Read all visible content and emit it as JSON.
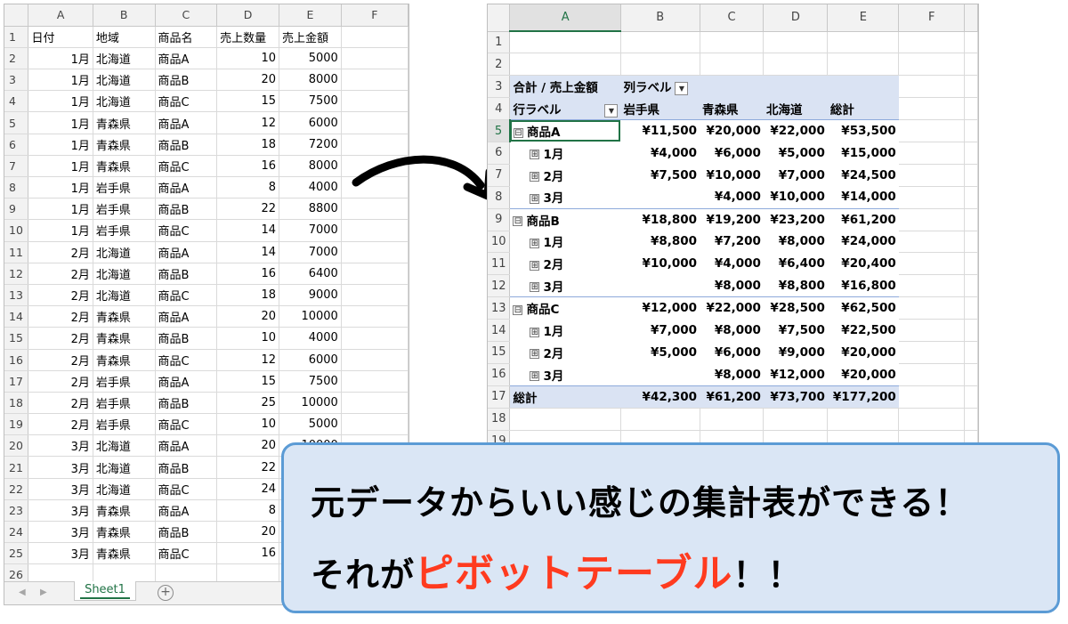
{
  "left_sheet": {
    "columns": [
      "A",
      "B",
      "C",
      "D",
      "E",
      "F"
    ],
    "headers": [
      "日付",
      "地域",
      "商品名",
      "売上数量",
      "売上金額"
    ],
    "rows": [
      [
        "1月",
        "北海道",
        "商品A",
        "10",
        "5000"
      ],
      [
        "1月",
        "北海道",
        "商品B",
        "20",
        "8000"
      ],
      [
        "1月",
        "北海道",
        "商品C",
        "15",
        "7500"
      ],
      [
        "1月",
        "青森県",
        "商品A",
        "12",
        "6000"
      ],
      [
        "1月",
        "青森県",
        "商品B",
        "18",
        "7200"
      ],
      [
        "1月",
        "青森県",
        "商品C",
        "16",
        "8000"
      ],
      [
        "1月",
        "岩手県",
        "商品A",
        "8",
        "4000"
      ],
      [
        "1月",
        "岩手県",
        "商品B",
        "22",
        "8800"
      ],
      [
        "1月",
        "岩手県",
        "商品C",
        "14",
        "7000"
      ],
      [
        "2月",
        "北海道",
        "商品A",
        "14",
        "7000"
      ],
      [
        "2月",
        "北海道",
        "商品B",
        "16",
        "6400"
      ],
      [
        "2月",
        "北海道",
        "商品C",
        "18",
        "9000"
      ],
      [
        "2月",
        "青森県",
        "商品A",
        "20",
        "10000"
      ],
      [
        "2月",
        "青森県",
        "商品B",
        "10",
        "4000"
      ],
      [
        "2月",
        "青森県",
        "商品C",
        "12",
        "6000"
      ],
      [
        "2月",
        "岩手県",
        "商品A",
        "15",
        "7500"
      ],
      [
        "2月",
        "岩手県",
        "商品B",
        "25",
        "10000"
      ],
      [
        "2月",
        "岩手県",
        "商品C",
        "10",
        "5000"
      ],
      [
        "3月",
        "北海道",
        "商品A",
        "20",
        "10000"
      ],
      [
        "3月",
        "北海道",
        "商品B",
        "22",
        ""
      ],
      [
        "3月",
        "北海道",
        "商品C",
        "24",
        ""
      ],
      [
        "3月",
        "青森県",
        "商品A",
        "8",
        ""
      ],
      [
        "3月",
        "青森県",
        "商品B",
        "20",
        ""
      ],
      [
        "3月",
        "青森県",
        "商品C",
        "16",
        ""
      ]
    ],
    "row_numbers": [
      "1",
      "2",
      "3",
      "4",
      "5",
      "6",
      "7",
      "8",
      "9",
      "10",
      "11",
      "12",
      "13",
      "14",
      "15",
      "16",
      "17",
      "18",
      "19",
      "20",
      "21",
      "22",
      "23",
      "24",
      "25",
      "26"
    ],
    "sheet_tab": "Sheet1",
    "add_sheet": "+"
  },
  "right_sheet": {
    "columns": [
      "A",
      "B",
      "C",
      "D",
      "E",
      "F"
    ],
    "row_numbers": [
      "1",
      "2",
      "3",
      "4",
      "5",
      "6",
      "7",
      "8",
      "9",
      "10",
      "11",
      "12",
      "13",
      "14",
      "15",
      "16",
      "17",
      "18",
      "19"
    ],
    "pivot": {
      "value_label": "合計 / 売上金額",
      "column_label": "列ラベル",
      "row_label": "行ラベル",
      "col_headers": [
        "岩手県",
        "青森県",
        "北海道",
        "総計"
      ],
      "groups": [
        {
          "name": "商品A",
          "values": [
            "¥11,500",
            "¥20,000",
            "¥22,000",
            "¥53,500"
          ],
          "months": [
            {
              "name": "1月",
              "values": [
                "¥4,000",
                "¥6,000",
                "¥5,000",
                "¥15,000"
              ]
            },
            {
              "name": "2月",
              "values": [
                "¥7,500",
                "¥10,000",
                "¥7,000",
                "¥24,500"
              ]
            },
            {
              "name": "3月",
              "values": [
                "",
                "¥4,000",
                "¥10,000",
                "¥14,000"
              ]
            }
          ]
        },
        {
          "name": "商品B",
          "values": [
            "¥18,800",
            "¥19,200",
            "¥23,200",
            "¥61,200"
          ],
          "months": [
            {
              "name": "1月",
              "values": [
                "¥8,800",
                "¥7,200",
                "¥8,000",
                "¥24,000"
              ]
            },
            {
              "name": "2月",
              "values": [
                "¥10,000",
                "¥4,000",
                "¥6,400",
                "¥20,400"
              ]
            },
            {
              "name": "3月",
              "values": [
                "",
                "¥8,000",
                "¥8,800",
                "¥16,800"
              ]
            }
          ]
        },
        {
          "name": "商品C",
          "values": [
            "¥12,000",
            "¥22,000",
            "¥28,500",
            "¥62,500"
          ],
          "months": [
            {
              "name": "1月",
              "values": [
                "¥7,000",
                "¥8,000",
                "¥7,500",
                "¥22,500"
              ]
            },
            {
              "name": "2月",
              "values": [
                "¥5,000",
                "¥6,000",
                "¥9,000",
                "¥20,000"
              ]
            },
            {
              "name": "3月",
              "values": [
                "",
                "¥8,000",
                "¥12,000",
                "¥20,000"
              ]
            }
          ]
        }
      ],
      "total_label": "総計",
      "total_values": [
        "¥42,300",
        "¥61,200",
        "¥73,700",
        "¥177,200"
      ]
    }
  },
  "callout": {
    "line1": "元データからいい感じの集計表ができる！",
    "line2_prefix": "それが",
    "line2_highlight": "ピボットテーブル",
    "line2_suffix": "！！"
  },
  "colors": {
    "excel_green": "#217346",
    "pivot_header_fill": "#dae3f3",
    "callout_fill": "#dae6f5",
    "callout_border": "#5b9bd5",
    "highlight_red": "#ff3b1f"
  },
  "icons": {
    "collapse": "⊟",
    "expand": "⊞",
    "dropdown": "▼",
    "tab_prev": "◀",
    "tab_next": "▶"
  }
}
